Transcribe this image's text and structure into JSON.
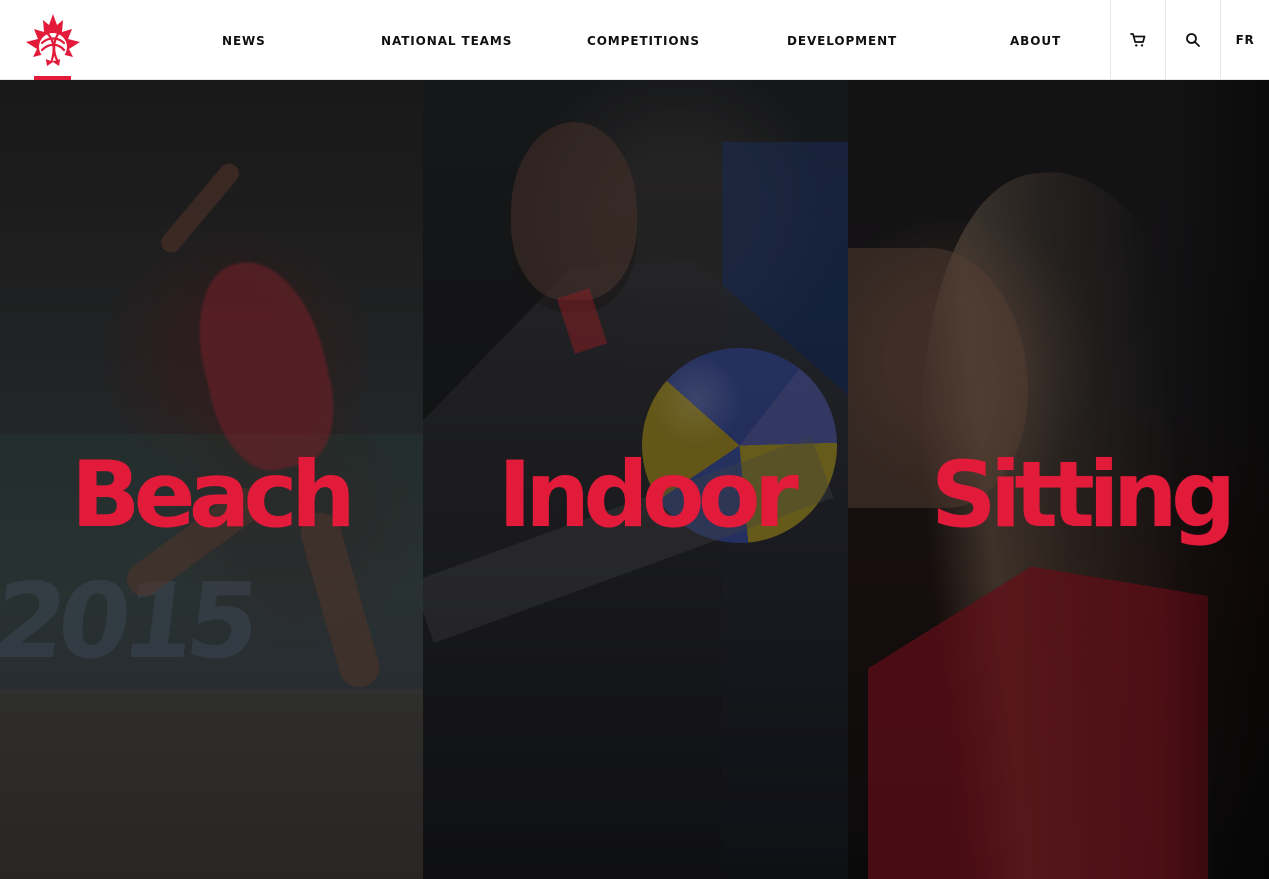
{
  "navigation": {
    "items": [
      {
        "label": "NEWS"
      },
      {
        "label": "NATIONAL TEAMS"
      },
      {
        "label": "COMPETITIONS"
      },
      {
        "label": "DEVELOPMENT"
      },
      {
        "label": "ABOUT"
      }
    ]
  },
  "utilities": {
    "cart_icon": "shopping-cart-icon",
    "search_icon": "search-icon",
    "language": "FR"
  },
  "brand": {
    "logo_icon": "maple-leaf-volleyball-logo",
    "accent": "#e31b3b"
  },
  "hero": {
    "panels": [
      {
        "label": "Beach"
      },
      {
        "label": "Indoor"
      },
      {
        "label": "Sitting"
      }
    ]
  }
}
